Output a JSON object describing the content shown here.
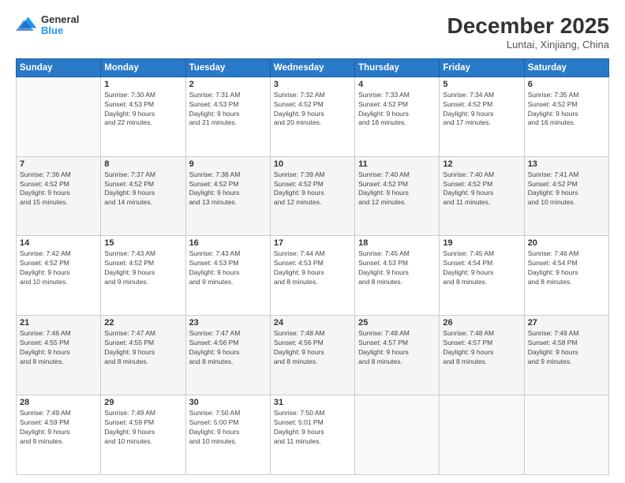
{
  "logo": {
    "line1": "General",
    "line2": "Blue"
  },
  "title": "December 2025",
  "subtitle": "Luntai, Xinjiang, China",
  "weekdays": [
    "Sunday",
    "Monday",
    "Tuesday",
    "Wednesday",
    "Thursday",
    "Friday",
    "Saturday"
  ],
  "weeks": [
    [
      {
        "day": "",
        "info": ""
      },
      {
        "day": "1",
        "info": "Sunrise: 7:30 AM\nSunset: 4:53 PM\nDaylight: 9 hours\nand 22 minutes."
      },
      {
        "day": "2",
        "info": "Sunrise: 7:31 AM\nSunset: 4:53 PM\nDaylight: 9 hours\nand 21 minutes."
      },
      {
        "day": "3",
        "info": "Sunrise: 7:32 AM\nSunset: 4:52 PM\nDaylight: 9 hours\nand 20 minutes."
      },
      {
        "day": "4",
        "info": "Sunrise: 7:33 AM\nSunset: 4:52 PM\nDaylight: 9 hours\nand 18 minutes."
      },
      {
        "day": "5",
        "info": "Sunrise: 7:34 AM\nSunset: 4:52 PM\nDaylight: 9 hours\nand 17 minutes."
      },
      {
        "day": "6",
        "info": "Sunrise: 7:35 AM\nSunset: 4:52 PM\nDaylight: 9 hours\nand 16 minutes."
      }
    ],
    [
      {
        "day": "7",
        "info": "Sunrise: 7:36 AM\nSunset: 4:52 PM\nDaylight: 9 hours\nand 15 minutes."
      },
      {
        "day": "8",
        "info": "Sunrise: 7:37 AM\nSunset: 4:52 PM\nDaylight: 9 hours\nand 14 minutes."
      },
      {
        "day": "9",
        "info": "Sunrise: 7:38 AM\nSunset: 4:52 PM\nDaylight: 9 hours\nand 13 minutes."
      },
      {
        "day": "10",
        "info": "Sunrise: 7:39 AM\nSunset: 4:52 PM\nDaylight: 9 hours\nand 12 minutes."
      },
      {
        "day": "11",
        "info": "Sunrise: 7:40 AM\nSunset: 4:52 PM\nDaylight: 9 hours\nand 12 minutes."
      },
      {
        "day": "12",
        "info": "Sunrise: 7:40 AM\nSunset: 4:52 PM\nDaylight: 9 hours\nand 11 minutes."
      },
      {
        "day": "13",
        "info": "Sunrise: 7:41 AM\nSunset: 4:52 PM\nDaylight: 9 hours\nand 10 minutes."
      }
    ],
    [
      {
        "day": "14",
        "info": "Sunrise: 7:42 AM\nSunset: 4:52 PM\nDaylight: 9 hours\nand 10 minutes."
      },
      {
        "day": "15",
        "info": "Sunrise: 7:43 AM\nSunset: 4:52 PM\nDaylight: 9 hours\nand 9 minutes."
      },
      {
        "day": "16",
        "info": "Sunrise: 7:43 AM\nSunset: 4:53 PM\nDaylight: 9 hours\nand 9 minutes."
      },
      {
        "day": "17",
        "info": "Sunrise: 7:44 AM\nSunset: 4:53 PM\nDaylight: 9 hours\nand 8 minutes."
      },
      {
        "day": "18",
        "info": "Sunrise: 7:45 AM\nSunset: 4:53 PM\nDaylight: 9 hours\nand 8 minutes."
      },
      {
        "day": "19",
        "info": "Sunrise: 7:45 AM\nSunset: 4:54 PM\nDaylight: 9 hours\nand 8 minutes."
      },
      {
        "day": "20",
        "info": "Sunrise: 7:46 AM\nSunset: 4:54 PM\nDaylight: 9 hours\nand 8 minutes."
      }
    ],
    [
      {
        "day": "21",
        "info": "Sunrise: 7:46 AM\nSunset: 4:55 PM\nDaylight: 9 hours\nand 8 minutes."
      },
      {
        "day": "22",
        "info": "Sunrise: 7:47 AM\nSunset: 4:55 PM\nDaylight: 9 hours\nand 8 minutes."
      },
      {
        "day": "23",
        "info": "Sunrise: 7:47 AM\nSunset: 4:56 PM\nDaylight: 9 hours\nand 8 minutes."
      },
      {
        "day": "24",
        "info": "Sunrise: 7:48 AM\nSunset: 4:56 PM\nDaylight: 9 hours\nand 8 minutes."
      },
      {
        "day": "25",
        "info": "Sunrise: 7:48 AM\nSunset: 4:57 PM\nDaylight: 9 hours\nand 8 minutes."
      },
      {
        "day": "26",
        "info": "Sunrise: 7:48 AM\nSunset: 4:57 PM\nDaylight: 9 hours\nand 8 minutes."
      },
      {
        "day": "27",
        "info": "Sunrise: 7:49 AM\nSunset: 4:58 PM\nDaylight: 9 hours\nand 9 minutes."
      }
    ],
    [
      {
        "day": "28",
        "info": "Sunrise: 7:49 AM\nSunset: 4:59 PM\nDaylight: 9 hours\nand 9 minutes."
      },
      {
        "day": "29",
        "info": "Sunrise: 7:49 AM\nSunset: 4:59 PM\nDaylight: 9 hours\nand 10 minutes."
      },
      {
        "day": "30",
        "info": "Sunrise: 7:50 AM\nSunset: 5:00 PM\nDaylight: 9 hours\nand 10 minutes."
      },
      {
        "day": "31",
        "info": "Sunrise: 7:50 AM\nSunset: 5:01 PM\nDaylight: 9 hours\nand 11 minutes."
      },
      {
        "day": "",
        "info": ""
      },
      {
        "day": "",
        "info": ""
      },
      {
        "day": "",
        "info": ""
      }
    ]
  ]
}
